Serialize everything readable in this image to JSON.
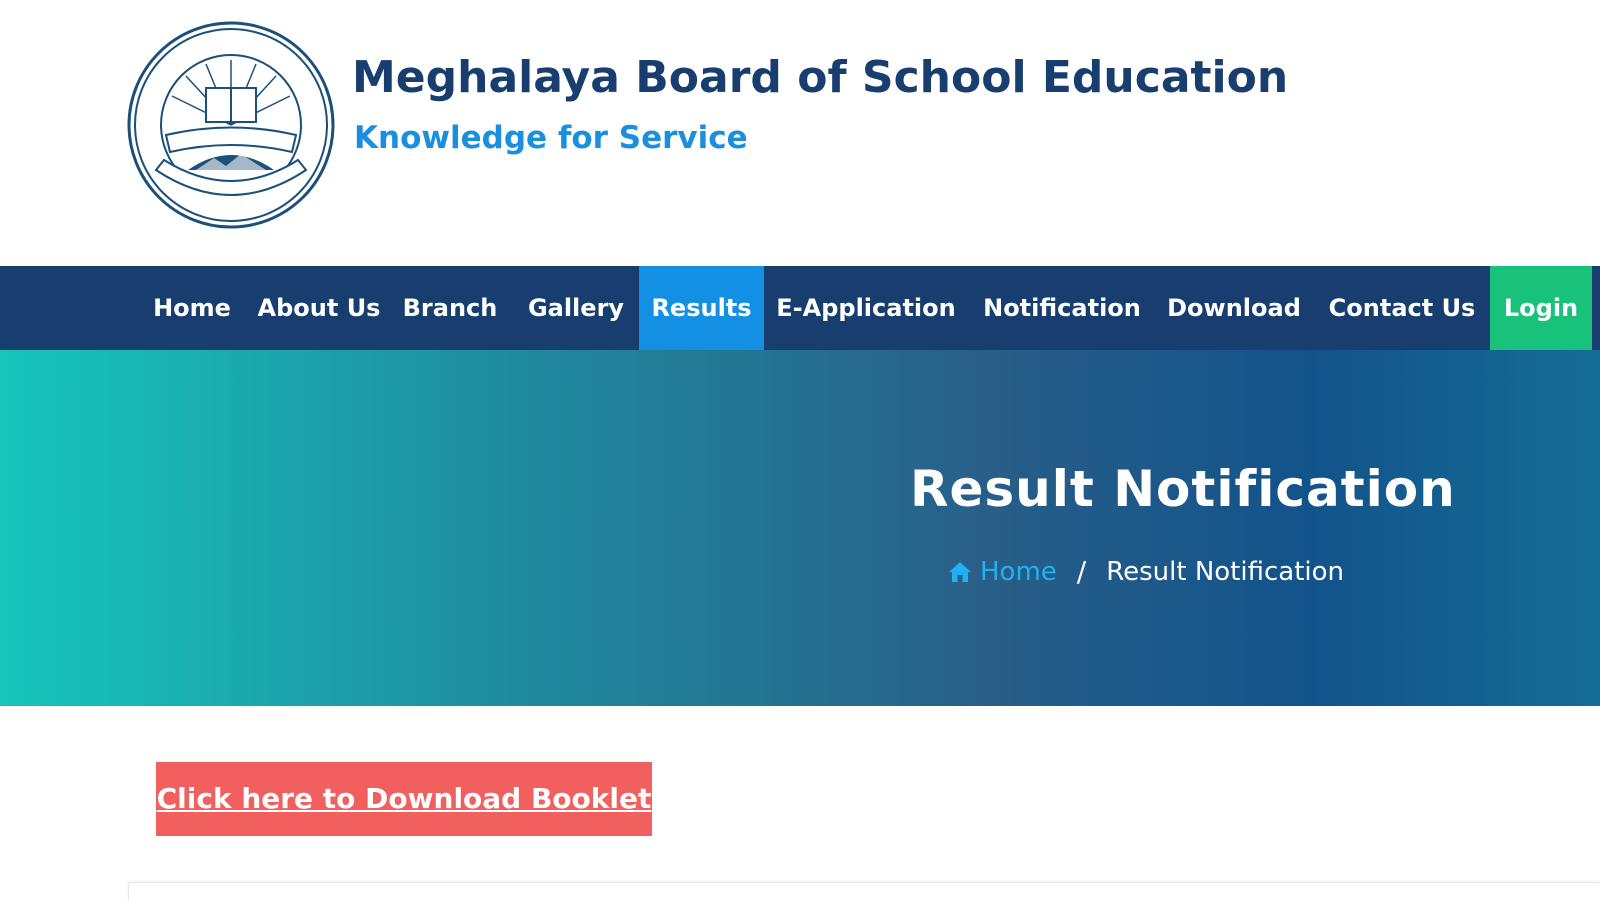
{
  "header": {
    "title": "Meghalaya Board of School Education",
    "tagline": "Knowledge for Service",
    "logo_icon": "mbose-seal-logo"
  },
  "nav": {
    "items": [
      {
        "label": "Home"
      },
      {
        "label": "About Us"
      },
      {
        "label": "Branch"
      },
      {
        "label": "Gallery"
      },
      {
        "label": "Results",
        "active": true
      },
      {
        "label": "E-Application"
      },
      {
        "label": "Notification"
      },
      {
        "label": "Download"
      },
      {
        "label": "Contact Us"
      },
      {
        "label": "Login"
      }
    ]
  },
  "banner": {
    "title": "Result Notification",
    "breadcrumb": {
      "home_label": "Home",
      "separator": "/",
      "current": "Result Notification"
    }
  },
  "main": {
    "download_button_label": "Click here to Download Booklet"
  },
  "colors": {
    "nav_bg": "#173e6e",
    "nav_active": "#1390e3",
    "login_bg": "#19c27a",
    "button_bg": "#f15f5e",
    "title_color": "#183e6f",
    "tagline_color": "#1a8fe0"
  }
}
